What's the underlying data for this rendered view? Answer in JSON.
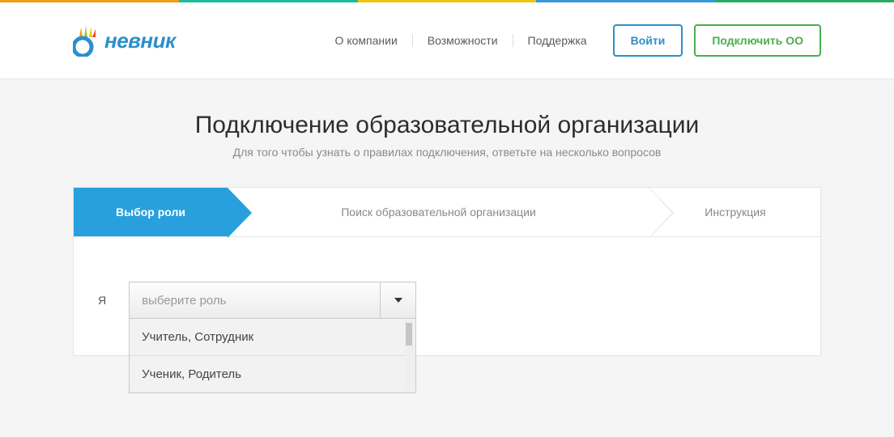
{
  "header": {
    "logo_text": "невник",
    "nav": [
      {
        "label": "О компании"
      },
      {
        "label": "Возможности"
      },
      {
        "label": "Поддержка"
      }
    ],
    "login_button": "Войти",
    "connect_button": "Подключить ОО"
  },
  "page": {
    "title": "Подключение образовательной организации",
    "subtitle": "Для того чтобы узнать о правилах подключения, ответьте на несколько вопросов"
  },
  "steps": [
    {
      "label": "Выбор роли",
      "active": true
    },
    {
      "label": "Поиск образовательной организации",
      "active": false
    },
    {
      "label": "Инструкция",
      "active": false
    }
  ],
  "form": {
    "prefix": "Я",
    "dropdown": {
      "placeholder": "выберите роль",
      "options": [
        "Учитель, Сотрудник",
        "Ученик, Родитель"
      ]
    }
  }
}
